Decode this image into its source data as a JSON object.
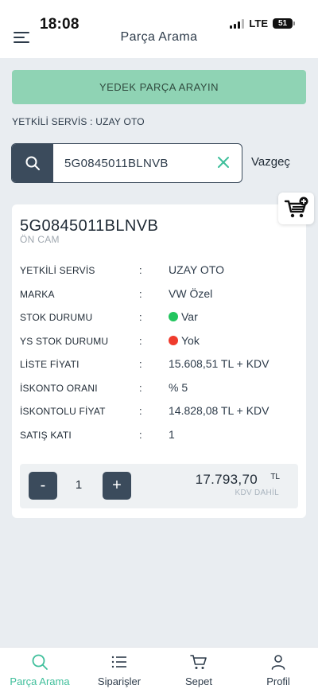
{
  "status_bar": {
    "time": "18:08",
    "network": "LTE",
    "battery": "51"
  },
  "header": {
    "title": "Parça Arama"
  },
  "search_parts_button": "YEDEK PARÇA ARAYIN",
  "authorized_service_line": "YETKİLİ SERVİS : UZAY OTO",
  "search": {
    "value": "5G0845011BLNVB",
    "cancel_label": "Vazgeç"
  },
  "part": {
    "number": "5G0845011BLNVB",
    "name": "ÖN CAM",
    "details": [
      {
        "label": "YETKİLİ SERVİS",
        "value": "UZAY OTO"
      },
      {
        "label": "MARKA",
        "value": "VW Özel"
      },
      {
        "label": "STOK DURUMU",
        "value": "Var",
        "indicator_color": "#22c55e"
      },
      {
        "label": "YS STOK DURUMU",
        "value": "Yok",
        "indicator_color": "#ef3b2d"
      },
      {
        "label": "LİSTE FİYATI",
        "value": "15.608,51 TL + KDV"
      },
      {
        "label": "İSKONTO ORANI",
        "value": "% 5"
      },
      {
        "label": "İSKONTOLU FİYAT",
        "value": "14.828,08 TL + KDV"
      },
      {
        "label": "SATIŞ KATI",
        "value": "1"
      }
    ],
    "colon": ":"
  },
  "quantity": {
    "minus": "-",
    "value": "1",
    "plus": "+"
  },
  "total": {
    "amount": "17.793,70",
    "currency": "TL",
    "vat_note": "KDV DAHİL"
  },
  "bottom_nav": [
    {
      "label": "Parça Arama",
      "icon": "search-icon",
      "active": true
    },
    {
      "label": "Siparişler",
      "icon": "list-icon",
      "active": false
    },
    {
      "label": "Sepet",
      "icon": "cart-icon",
      "active": false
    },
    {
      "label": "Profil",
      "icon": "user-icon",
      "active": false
    }
  ],
  "colors": {
    "accent": "#3fbf9b",
    "primary_button": "#8fd3b4",
    "dark": "#3b4b5c"
  }
}
